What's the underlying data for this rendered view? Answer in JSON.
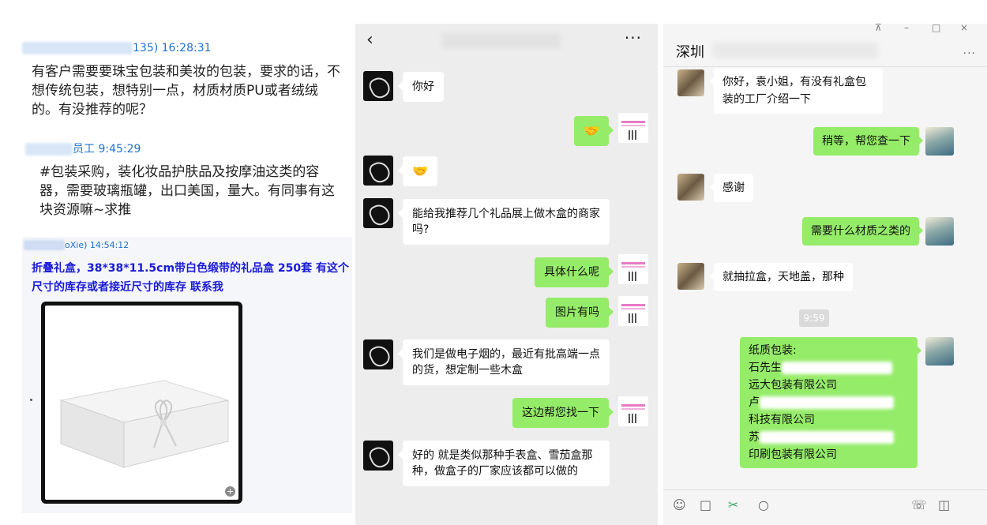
{
  "left_panel": {
    "msg1": {
      "sender_visible": "135) 16:28:31",
      "text": "有客户需要要珠宝包装和美妆的包装，要求的话，不想传统包装，想特别一点，材质材质PU或者绒绒的。有没推荐的呢？"
    },
    "msg2": {
      "sender_visible": "员工 9:45:29",
      "text": "#包装采购，装化妆品护肤品及按摩油这类的容器，需要玻璃瓶罐，出口美国，量大。有同事有这块资源嘛~求推"
    },
    "msg3": {
      "sender_visible": "oXie)  14:54:12",
      "text": "折叠礼盒，38*38*11.5cm带白色缎带的礼品盒 250套 有这个尺寸的库存或者接近尺寸的库存 联系我"
    }
  },
  "middle_panel": {
    "back_icon": "chevron-left",
    "more_icon": "···",
    "messages": [
      {
        "side": "in",
        "text": "你好"
      },
      {
        "side": "out",
        "text": "🤝"
      },
      {
        "side": "in",
        "text": "🤝"
      },
      {
        "side": "in",
        "text": "能给我推荐几个礼品展上做木盒的商家吗?"
      },
      {
        "side": "out",
        "text": "具体什么呢"
      },
      {
        "side": "out",
        "text": "图片有吗"
      },
      {
        "side": "in",
        "text": "我们是做电子烟的，最近有批高端一点的货，想定制一些木盒"
      },
      {
        "side": "out",
        "text": "这边帮您找一下"
      },
      {
        "side": "in",
        "text": "好的 就是类似那种手表盒、雪茄盒那种，做盒子的厂家应该都可以做的"
      }
    ]
  },
  "right_panel": {
    "title_visible": "深圳",
    "more_icon": "···",
    "window_controls": [
      "⊼",
      "–",
      "□",
      "×"
    ],
    "messages": [
      {
        "side": "in",
        "text": "你好，袁小姐，有没有礼盒包装的工厂介绍一下"
      },
      {
        "side": "out",
        "text": "稍等，帮您查一下"
      },
      {
        "side": "in",
        "text": "感谢"
      },
      {
        "side": "out",
        "text": "需要什么材质之类的"
      },
      {
        "side": "in",
        "text": "就抽拉盒，天地盖，那种"
      }
    ],
    "time_label": "9:59",
    "list_message": {
      "heading": "纸质包装:",
      "lines": [
        "石先生",
        "远大包装有限公司",
        "卢",
        "科技有限公司",
        "苏",
        "印刷包装有限公司"
      ]
    },
    "toolbar_icons": [
      "smile-icon",
      "folder-icon",
      "scissors-icon",
      "chat-icon",
      "phone-icon",
      "video-icon"
    ]
  }
}
